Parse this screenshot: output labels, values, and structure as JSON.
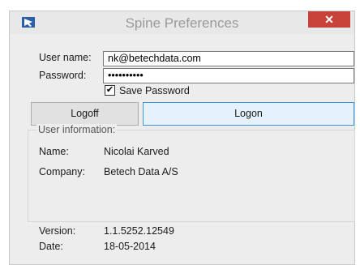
{
  "window": {
    "title": "Spine Preferences",
    "close_glyph": "✕",
    "icon": "app-icon",
    "colors": {
      "title_bar": "#e8e8e8",
      "close_button": "#c7433a",
      "logon_border": "#3c95d9"
    }
  },
  "login": {
    "username_label": "User name:",
    "username_value": "nk@betechdata.com",
    "password_label": "Password:",
    "password_value": "••••••••••",
    "save_password_label": "Save Password",
    "save_password_checked": true
  },
  "buttons": {
    "logoff": "Logoff",
    "logon": "Logon"
  },
  "user_info": {
    "legend": "User information:",
    "name_label": "Name:",
    "name_value": "Nicolai Karved",
    "company_label": "Company:",
    "company_value": "Betech Data A/S"
  },
  "about": {
    "version_label": "Version:",
    "version_value": "1.1.5252.12549",
    "date_label": "Date:",
    "date_value": "18-05-2014"
  }
}
